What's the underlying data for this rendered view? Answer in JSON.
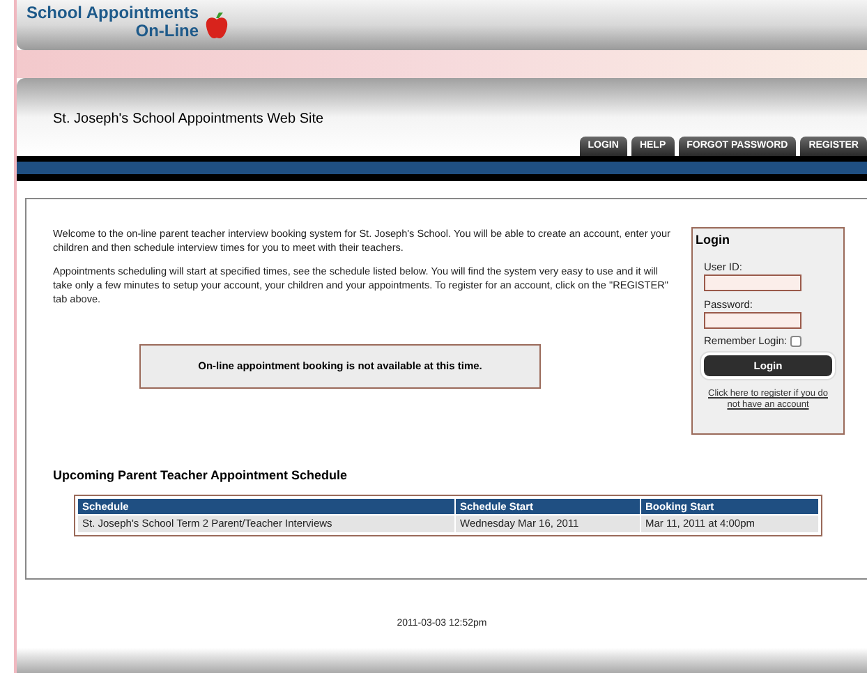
{
  "logo": {
    "line_1": "School Appointments",
    "line_2": "On-Line"
  },
  "site_title": "St. Joseph's School Appointments Web Site",
  "tabs": [
    {
      "label": "LOGIN"
    },
    {
      "label": "HELP"
    },
    {
      "label": "FORGOT PASSWORD"
    },
    {
      "label": "REGISTER"
    }
  ],
  "intro": [
    "Welcome to the on-line parent teacher interview booking system for St. Joseph's School. You will be able to create an account, enter your children and then schedule interview times for you to meet with their teachers.",
    "Appointments scheduling will start at specified times, see the schedule listed below. You will find the system very easy to use and it will take only a few minutes to setup your account, your children and your appointments. To register for an account, click on the \"REGISTER\" tab above."
  ],
  "notice": "On-line appointment booking is not available at this time.",
  "login": {
    "title": "Login",
    "user_id_label": "User ID:",
    "password_label": "Password:",
    "remember_label": "Remember Login:",
    "remember_checked": false,
    "button": "Login",
    "register_link": "Click here to register if you do not have an account"
  },
  "schedule": {
    "title": "Upcoming Parent Teacher Appointment Schedule",
    "columns": [
      "Schedule",
      "Schedule Start",
      "Booking Start"
    ],
    "rows": [
      [
        "St. Joseph's School Term 2 Parent/Teacher Interviews",
        "Wednesday Mar 16, 2011",
        "Mar 11, 2011 at 4:00pm"
      ]
    ]
  },
  "footer": "2011-03-03 12:52pm"
}
